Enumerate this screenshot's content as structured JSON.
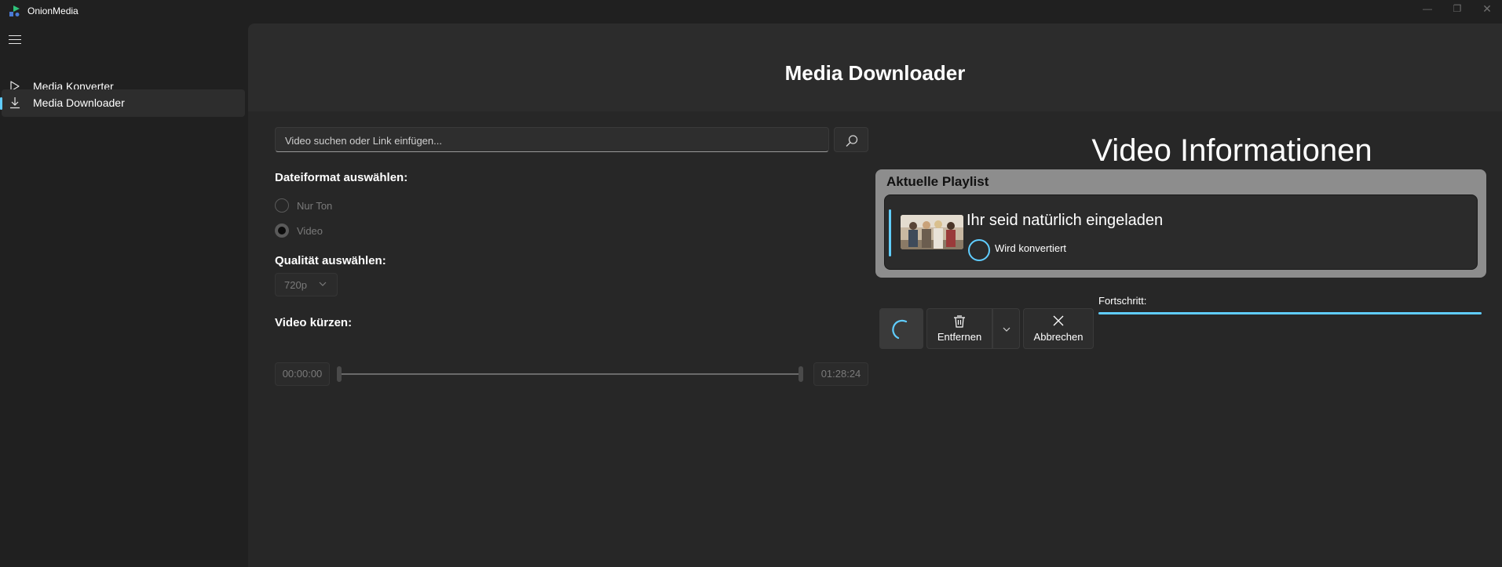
{
  "app": {
    "title": "OnionMedia"
  },
  "window_controls": {
    "minimize": "—",
    "maximize": "❐",
    "close": "✕"
  },
  "sidebar": {
    "items": [
      {
        "label": "Media Konverter",
        "icon": "play-icon",
        "selected": false
      },
      {
        "label": "Media Downloader",
        "icon": "download-icon",
        "selected": true
      }
    ]
  },
  "page": {
    "title": "Media Downloader"
  },
  "search": {
    "placeholder": "Video suchen oder Link einfügen...",
    "value": ""
  },
  "format": {
    "label": "Dateiformat auswählen:",
    "options": [
      {
        "label": "Nur Ton",
        "checked": false
      },
      {
        "label": "Video",
        "checked": true
      }
    ]
  },
  "quality": {
    "label": "Qualität auswählen:",
    "value": "720p"
  },
  "trim": {
    "label": "Video kürzen:",
    "start": "00:00:00",
    "end": "01:28:24"
  },
  "info": {
    "title": "Video Informationen"
  },
  "playlist": {
    "title": "Aktuelle Playlist",
    "items": [
      {
        "title": "Ihr seid natürlich eingeladen",
        "status": "Wird konvertiert"
      }
    ]
  },
  "toolbar": {
    "remove_label": "Entfernen",
    "cancel_label": "Abbrechen"
  },
  "progress": {
    "label": "Fortschritt:",
    "value": 1.0
  },
  "colors": {
    "accent": "#60cdff",
    "background": "#202020",
    "panel": "#272727",
    "playlist_bg": "#8d8d8d"
  }
}
